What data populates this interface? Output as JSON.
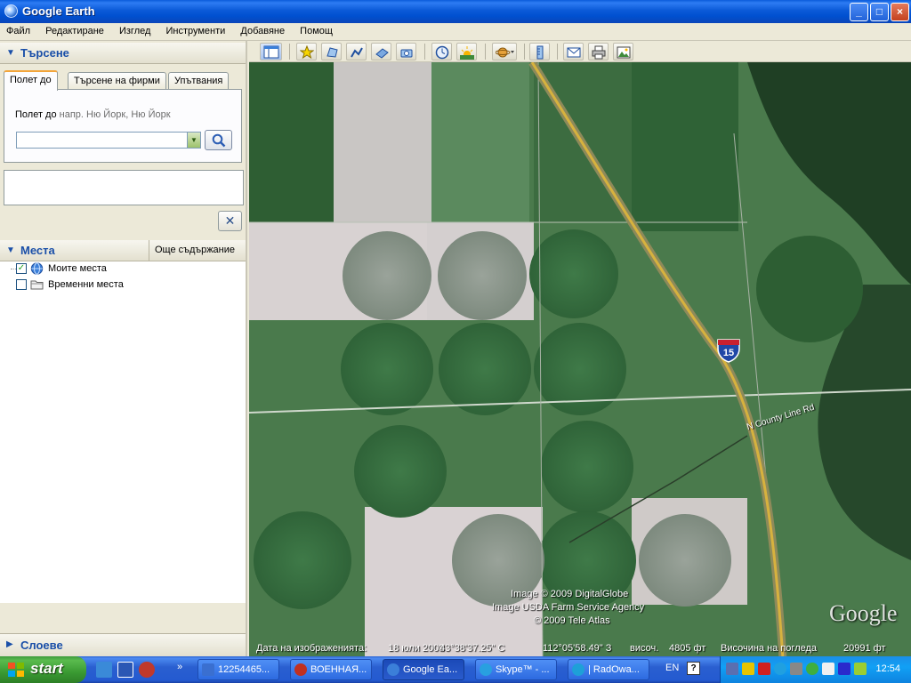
{
  "window": {
    "title": "Google Earth",
    "controls": [
      "_",
      "□",
      "×"
    ]
  },
  "menu": [
    "Файл",
    "Редактиране",
    "Изглед",
    "Инструменти",
    "Добавяне",
    "Помощ"
  ],
  "search": {
    "title": "Търсене",
    "tabs": [
      "Полет до",
      "Търсене на фирми",
      "Упътвания"
    ],
    "active_tab": "Полет до",
    "fly_label": "Полет до",
    "fly_placeholder": "напр. Ню Йорк, Ню Йорк",
    "input_value": ""
  },
  "places": {
    "title": "Места",
    "more_button": "Още съдържание",
    "items": [
      {
        "label": "Моите места",
        "checked": true,
        "icon": "globe-icon"
      },
      {
        "label": "Временни места",
        "checked": false,
        "icon": "folder-icon"
      }
    ]
  },
  "layers": {
    "title": "Слоеве"
  },
  "toolbar": {
    "buttons": [
      "sidebar-toggle",
      "placemark",
      "polygon",
      "path",
      "image-overlay",
      "record-tour",
      "historical-imagery",
      "sunlight",
      "switch-to-sky",
      "ruler",
      "email",
      "print",
      "save-image"
    ]
  },
  "map": {
    "route_shield": "15",
    "road_label": "N County Line Rd",
    "credits": [
      "Image © 2009 DigitalGlobe",
      "Image USDA Farm Service Agency",
      "© 2009 Tele Atlas"
    ],
    "logo": "Google"
  },
  "status": {
    "imagery_date_label": "Дата на изображенията:",
    "imagery_date": "18 юли 2003",
    "lat": "43°38'37.25\" С",
    "lon": "112°05'58.49\" З",
    "elev_label": "височ.",
    "elev": "4805 фт",
    "eye_label": "Височина на погледа",
    "eye": "20991 фт"
  },
  "taskbar": {
    "start": "start",
    "tasks": [
      {
        "label": "12254465...",
        "active": false,
        "color": "#3a6fd0"
      },
      {
        "label": "ВОЕННАЯ...",
        "active": false,
        "color": "#c03020"
      },
      {
        "label": "Google Ea...",
        "active": true,
        "color": "#3b7fd9"
      },
      {
        "label": "Skype™ - ...",
        "active": false,
        "color": "#28a0e0"
      },
      {
        "label": "| RadOwa...",
        "active": false,
        "color": "#1ea0d8"
      }
    ],
    "lang": "EN",
    "clock": "12:54"
  }
}
